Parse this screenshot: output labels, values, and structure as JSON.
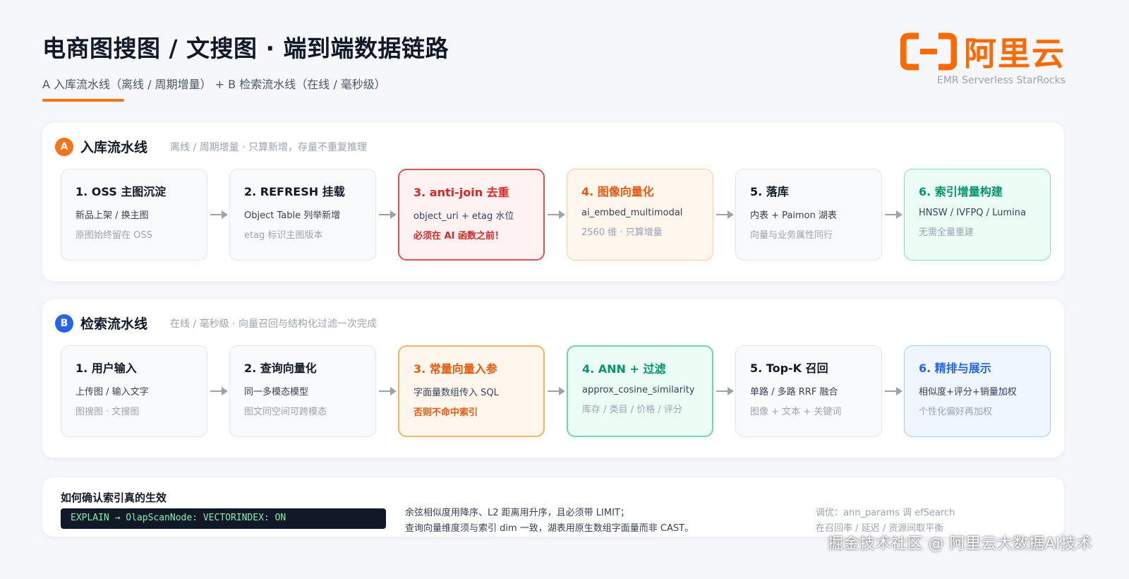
{
  "header": {
    "title": "电商图搜图 / 文搜图 · 端到端数据链路",
    "subtitle": "A 入库流水线（离线 / 周期增量） + B 检索流水线（在线 / 毫秒级）"
  },
  "brand": {
    "name": "阿里云",
    "product": "EMR Serverless StarRocks",
    "icon": "alibaba-cloud-logo",
    "color": "#ff6a00"
  },
  "pipeline_a": {
    "badge": "A",
    "name": "入库流水线",
    "desc": "离线 / 周期增量 · 只算新增，存量不重复推理",
    "steps": [
      {
        "title": "1. OSS 主图沉淀",
        "line": "新品上架 / 换主图",
        "note": "原图始终留在 OSS"
      },
      {
        "title": "2. REFRESH 挂载",
        "line": "Object Table 列举新增",
        "note": "etag 标识主图版本"
      },
      {
        "title": "3. anti-join 去重",
        "line": "object_uri + etag 水位",
        "note": "必须在 AI 函数之前！"
      },
      {
        "title": "4. 图像向量化",
        "line": "ai_embed_multimodal",
        "note": "2560 维 · 只算增量"
      },
      {
        "title": "5. 落库",
        "line": "内表 + Paimon 湖表",
        "note": "向量与业务属性同行"
      },
      {
        "title": "6. 索引增量构建",
        "line": "HNSW / IVFPQ / Lumina",
        "note": "无需全量重建"
      }
    ]
  },
  "pipeline_b": {
    "badge": "B",
    "name": "检索流水线",
    "desc": "在线 / 毫秒级 · 向量召回与结构化过滤一次完成",
    "steps": [
      {
        "title": "1. 用户输入",
        "line": "上传图 / 输入文字",
        "note": "图搜图 · 文搜图"
      },
      {
        "title": "2. 查询向量化",
        "line": "同一多模态模型",
        "note": "图文同空间可跨模态"
      },
      {
        "title": "3. 常量向量入参",
        "line": "字面量数组传入 SQL",
        "note": "否则不命中索引"
      },
      {
        "title": "4. ANN + 过滤",
        "line": "approx_cosine_similarity",
        "note": "库存 / 类目 / 价格 / 评分"
      },
      {
        "title": "5. Top-K 召回",
        "line": "单路 / 多路 RRF 融合",
        "note": "图像 + 文本 + 关键词"
      },
      {
        "title": "6. 精排与展示",
        "line": "相似度+评分+销量加权",
        "note": "个性化偏好再加权"
      }
    ]
  },
  "verify": {
    "title": "如何确认索引真的生效",
    "code": "EXPLAIN → OlapScanNode: VECTORINDEX: ON",
    "mid_line1": "余弦相似度用降序、L2 距离用升序，且必须带 LIMIT；",
    "mid_line2": "查询向量维度须与索引 dim 一致，湖表用原生数组字面量而非 CAST。",
    "right_line1": "调优：ann_params 调 efSearch",
    "right_line2": "在召回率 / 延迟 / 资源间取平衡"
  },
  "watermark": "掘金技术社区 @ 阿里云大数据AI技术"
}
